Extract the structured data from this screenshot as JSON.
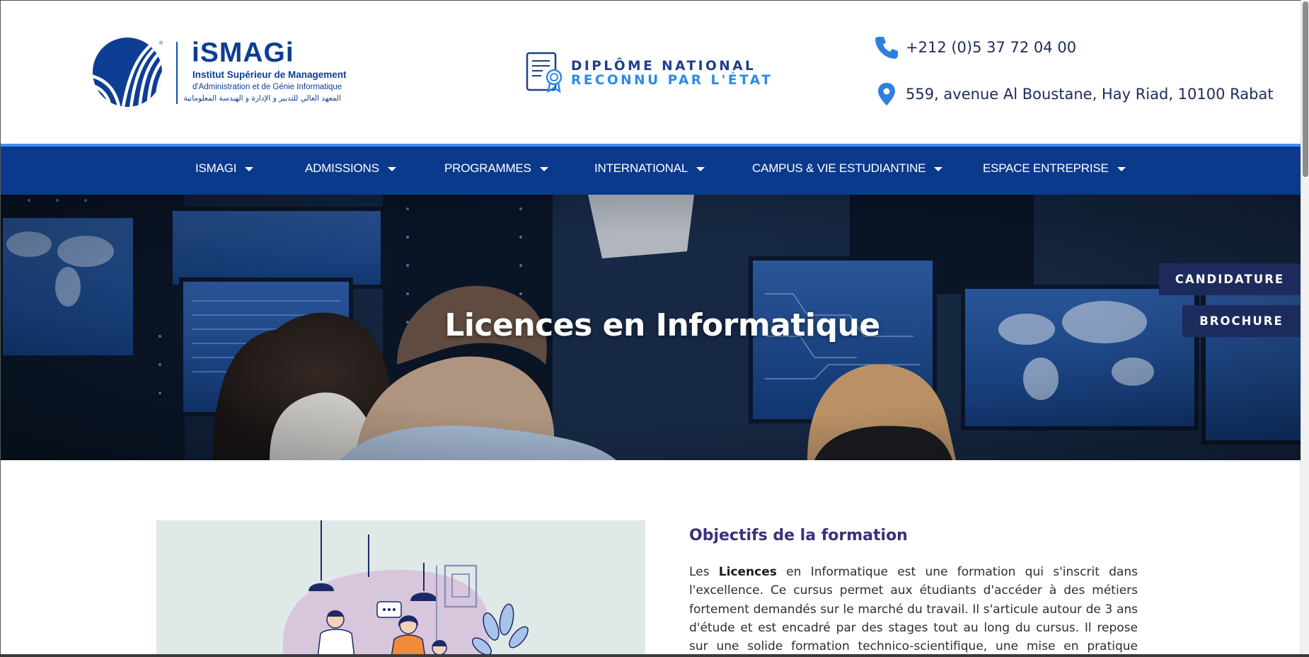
{
  "header": {
    "logo": {
      "brand": "iSMAGi",
      "line1": "Institut Supérieur de Management",
      "line2": "d'Administration et de Génie Informatique",
      "line3": "المعهد العالي للتدبير و الإدارة و الهندسة المعلوماتية"
    },
    "diploma": {
      "line1": "DIPLÔME NATIONAL",
      "line2": "RECONNU PAR L'ÉTAT"
    },
    "contact": {
      "phone": "+212 (0)5 37 72 04 00",
      "address": "559, avenue Al Boustane, Hay Riad, 10100 Rabat"
    }
  },
  "nav": {
    "items": [
      {
        "label": "ISMAGI"
      },
      {
        "label": "ADMISSIONS"
      },
      {
        "label": "PROGRAMMES"
      },
      {
        "label": "INTERNATIONAL"
      },
      {
        "label": "CAMPUS & VIE ESTUDIANTINE"
      },
      {
        "label": "ESPACE ENTREPRISE"
      }
    ]
  },
  "hero": {
    "title": "Licences en Informatique"
  },
  "side_buttons": {
    "candidature": "CANDIDATURE",
    "brochure": "BROCHURE"
  },
  "section": {
    "title": "Objectifs de la formation",
    "paragraph": {
      "p1": "Les ",
      "bold": "Licences",
      "p2": " en Informatique est une formation qui s'inscrit dans l'excellence. Ce cursus permet aux étudiants d'accéder à des métiers fortement demandés sur le marché du travail. Il s'articule autour de 3 ans d'étude et est encadré par des stages tout au long du cursus. Il repose sur une solide formation technico-scientifique, une mise en pratique régulière des"
    }
  },
  "colors": {
    "nav_bg": "#0b3a8c",
    "nav_accent": "#3f8ff0",
    "brand_blue": "#0d3e94",
    "side_button_bg": "#1d2b5c",
    "section_title": "#3e2f7a",
    "icon_blue": "#2d7fe0"
  },
  "icons": {
    "phone": "phone-icon",
    "address": "map-pin-icon",
    "diploma": "certificate-icon",
    "nav_caret": "caret-down-icon"
  }
}
